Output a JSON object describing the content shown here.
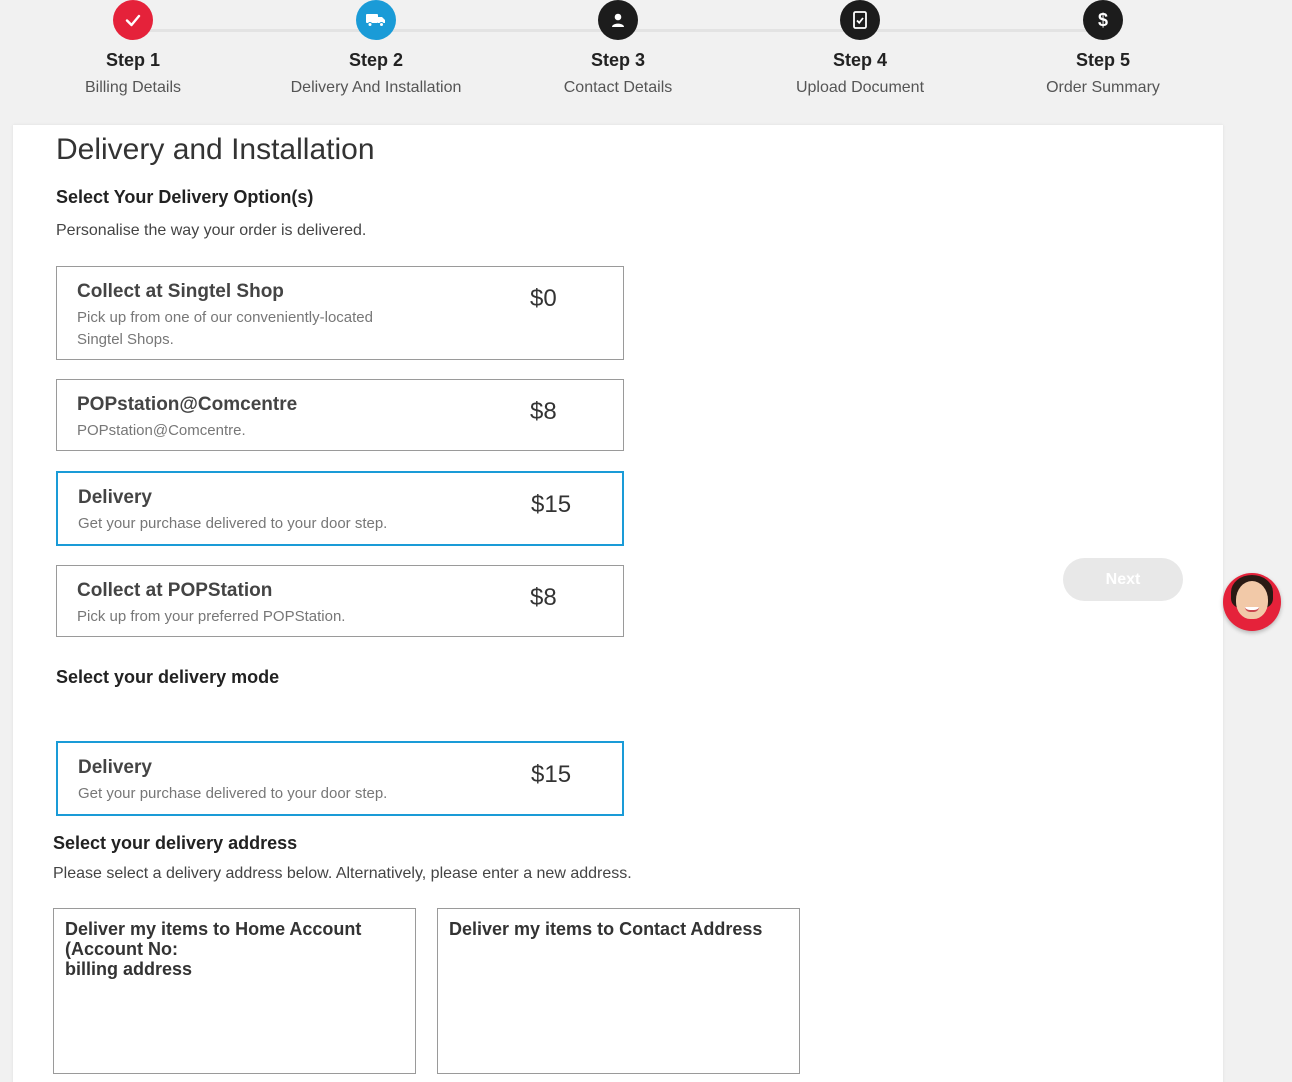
{
  "stepper": {
    "steps": [
      {
        "title": "Step 1",
        "subtitle": "Billing Details",
        "state": "done",
        "icon": "check-icon"
      },
      {
        "title": "Step 2",
        "subtitle": "Delivery And Installation",
        "state": "active",
        "icon": "truck-icon"
      },
      {
        "title": "Step 3",
        "subtitle": "Contact Details",
        "state": "todo",
        "icon": "user-icon"
      },
      {
        "title": "Step 4",
        "subtitle": "Upload Document",
        "state": "todo",
        "icon": "document-icon"
      },
      {
        "title": "Step 5",
        "subtitle": "Order Summary",
        "state": "todo",
        "icon": "dollar-icon"
      }
    ],
    "icons": {
      "check": "✓",
      "dollar": "$"
    },
    "colors": {
      "done": "#e5223a",
      "active": "#1a9bd7",
      "todo": "#1c1c1c"
    }
  },
  "page": {
    "title": "Delivery and Installation",
    "options_heading": "Select Your Delivery Option(s)",
    "options_sub": "Personalise the way your order is delivered.",
    "mode_heading": "Select your delivery mode",
    "address_heading": "Select your delivery address",
    "address_sub": "Please select a delivery address below. Alternatively, please enter a new address."
  },
  "delivery_options": [
    {
      "title": "Collect at Singtel Shop",
      "desc": "Pick up from one of our conveniently-located Singtel Shops.",
      "price": "$0",
      "selected": false
    },
    {
      "title": "POPstation@Comcentre",
      "desc": "POPstation@Comcentre.",
      "price": "$8",
      "selected": false
    },
    {
      "title": "Delivery",
      "desc": "Get your purchase delivered to your door step.",
      "price": "$15",
      "selected": true
    },
    {
      "title": "Collect at POPStation",
      "desc": "Pick up from your preferred POPStation.",
      "price": "$8",
      "selected": false
    }
  ],
  "delivery_mode": {
    "title": "Delivery",
    "desc": "Get your purchase delivered to your door step.",
    "price": "$15",
    "selected": true
  },
  "addresses": [
    {
      "line1": "Deliver my items to Home Account",
      "line2": "(Account No:",
      "line3": "billing address"
    },
    {
      "line1": "Deliver my items to Contact Address"
    }
  ],
  "actions": {
    "next_label": "Next"
  },
  "theme": {
    "accent": "#1a9bd7",
    "brand_red": "#e5223a"
  }
}
